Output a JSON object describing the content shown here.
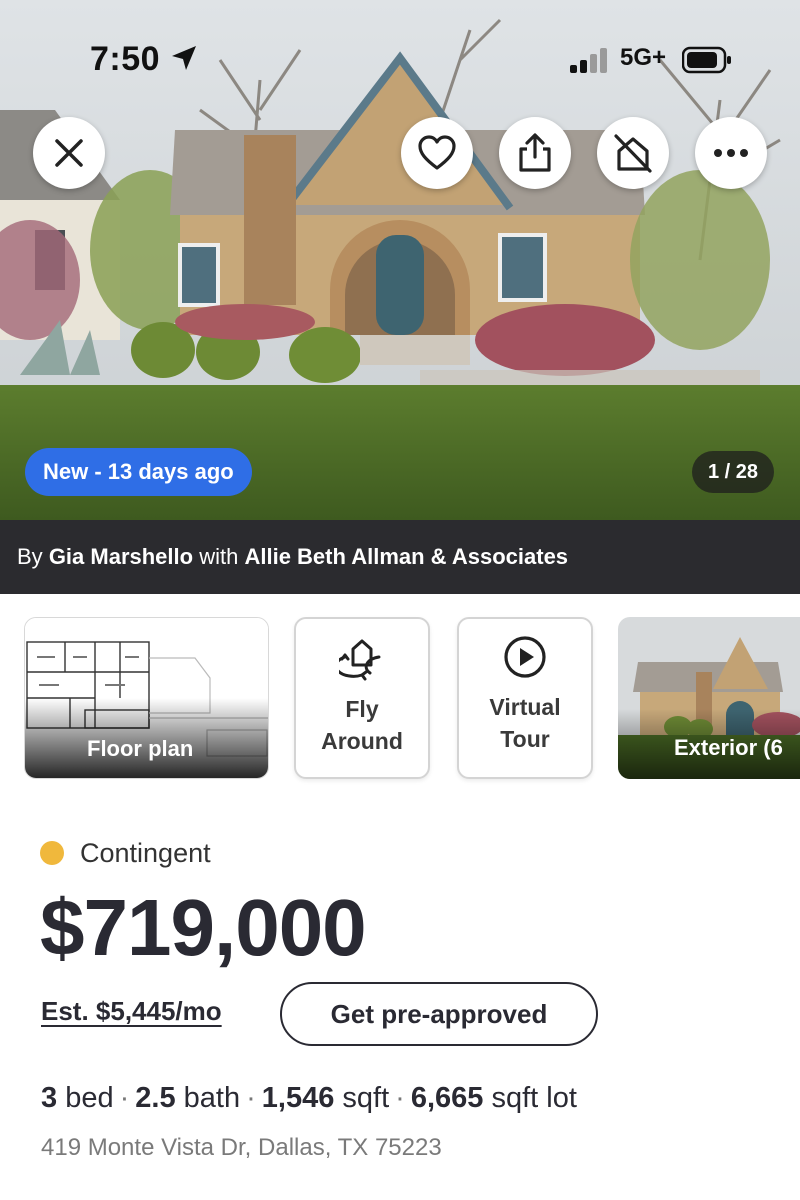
{
  "status_bar": {
    "time": "7:50",
    "network": "5G+",
    "icons": [
      "location-arrow-icon",
      "signal-icon",
      "battery-icon"
    ]
  },
  "hero": {
    "image_description_icon": "house-photo",
    "actions": [
      "close-icon",
      "heart-icon",
      "share-icon",
      "hide-home-icon",
      "more-icon"
    ],
    "badge": "New - 13 days ago",
    "photo_counter": "1 / 28"
  },
  "attribution": {
    "prefix": "By",
    "agent": "Gia Marshello",
    "middle": "with",
    "brokerage": "Allie Beth Allman & Associates"
  },
  "media": {
    "floor_plan": "Floor plan",
    "fly_around": "Fly Around",
    "virtual_tour": "Virtual Tour",
    "exterior": "Exterior (6"
  },
  "listing": {
    "status": "Contingent",
    "price": "$719,000",
    "est_payment": "Est. $5,445/mo",
    "preapproved_button": "Get pre-approved",
    "beds": "3",
    "beds_label": "bed",
    "baths": "2.5",
    "baths_label": "bath",
    "sqft": "1,546",
    "sqft_label": "sqft",
    "lot": "6,665",
    "lot_label": "sqft lot",
    "address": "419 Monte Vista Dr, Dallas, TX 75223"
  },
  "colors": {
    "badge_blue": "#2f6ee6",
    "status_yellow": "#f0b83c",
    "attribution_bg": "#2b2b2f",
    "text_dark": "#2a2a33"
  }
}
